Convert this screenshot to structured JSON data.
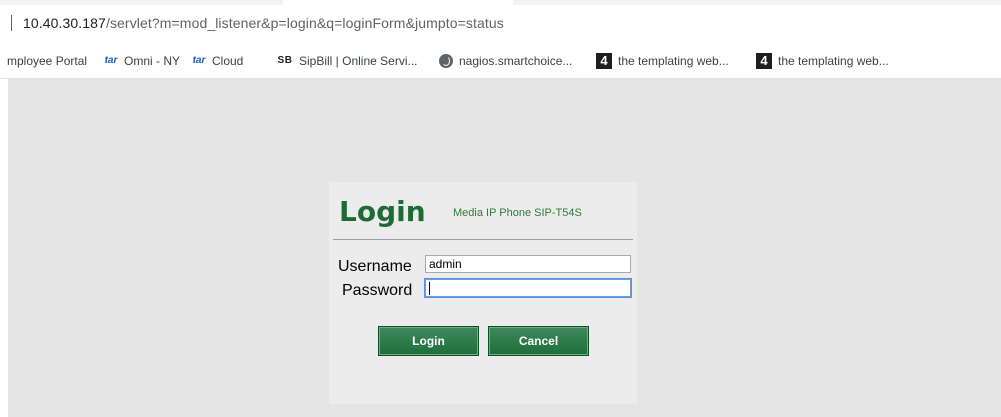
{
  "browser": {
    "url_host": "10.40.30.187",
    "url_path": "/servlet?m=mod_listener&p=login&q=loginForm&jumpto=status"
  },
  "bookmarks": [
    {
      "label": "mployee Portal",
      "icon": "none"
    },
    {
      "label": "Omni - NY",
      "icon": "tar-icon",
      "icon_text": "tar"
    },
    {
      "label": "Cloud",
      "icon": "tar-icon",
      "icon_text": "tar"
    },
    {
      "label": "SipBill | Online Servi...",
      "icon": "sb-icon",
      "icon_text": "SB"
    },
    {
      "label": "nagios.smartchoice...",
      "icon": "globe-icon"
    },
    {
      "label": "the templating web...",
      "icon": "four-icon",
      "icon_text": "4"
    },
    {
      "label": "the templating web...",
      "icon": "four-icon",
      "icon_text": "4"
    }
  ],
  "login": {
    "title": "Login",
    "device": "Media IP Phone SIP-T54S",
    "username_label": "Username",
    "password_label": "Password",
    "username_value": "admin",
    "password_value": "",
    "login_button": "Login",
    "cancel_button": "Cancel"
  },
  "colors": {
    "accent_green": "#1e6b35",
    "page_background": "#e5e5e5"
  }
}
